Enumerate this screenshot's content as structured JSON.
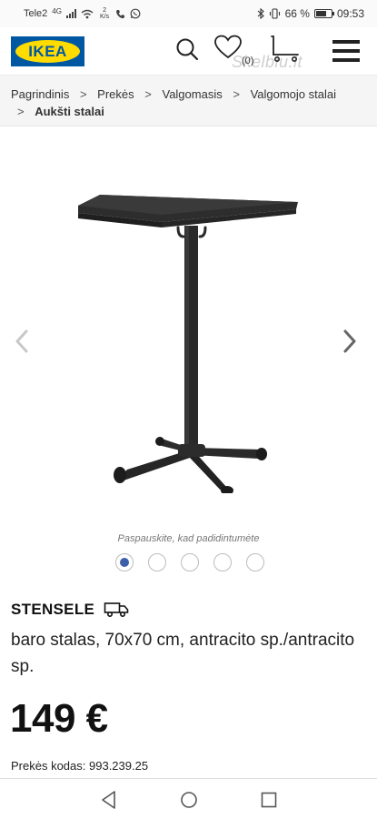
{
  "status_bar": {
    "carrier": "Tele2",
    "network": "4G",
    "speed_value": "2",
    "speed_unit": "K/s",
    "battery_percent": "66 %",
    "battery_level": 0.66,
    "time": "09:53"
  },
  "header": {
    "logo_text": "IKEA",
    "wishlist_count": "(0)",
    "watermark": "Skelbiu.lt"
  },
  "breadcrumb": {
    "items": [
      "Pagrindinis",
      "Prekės",
      "Valgomasis",
      "Valgomojo stalai"
    ],
    "separator": ">",
    "current": "Aukšti stalai"
  },
  "gallery": {
    "zoom_hint": "Paspauskite, kad padidintumėte",
    "total_images": 5,
    "active_index": 0
  },
  "product": {
    "name": "STENSELE",
    "description": "baro stalas, 70x70 cm, antracito sp./antracito sp.",
    "price": "149 €",
    "article_label": "Prekės kodas:",
    "article_number": "993.239.25"
  },
  "icons": {
    "search": "search-icon",
    "wishlist": "heart-icon",
    "cart": "cart-icon",
    "menu": "menu-icon",
    "delivery": "delivery-truck-icon"
  },
  "colors": {
    "ikea_blue": "#0058a3",
    "ikea_yellow": "#ffdb00",
    "active_dot": "#3d5ea9"
  }
}
